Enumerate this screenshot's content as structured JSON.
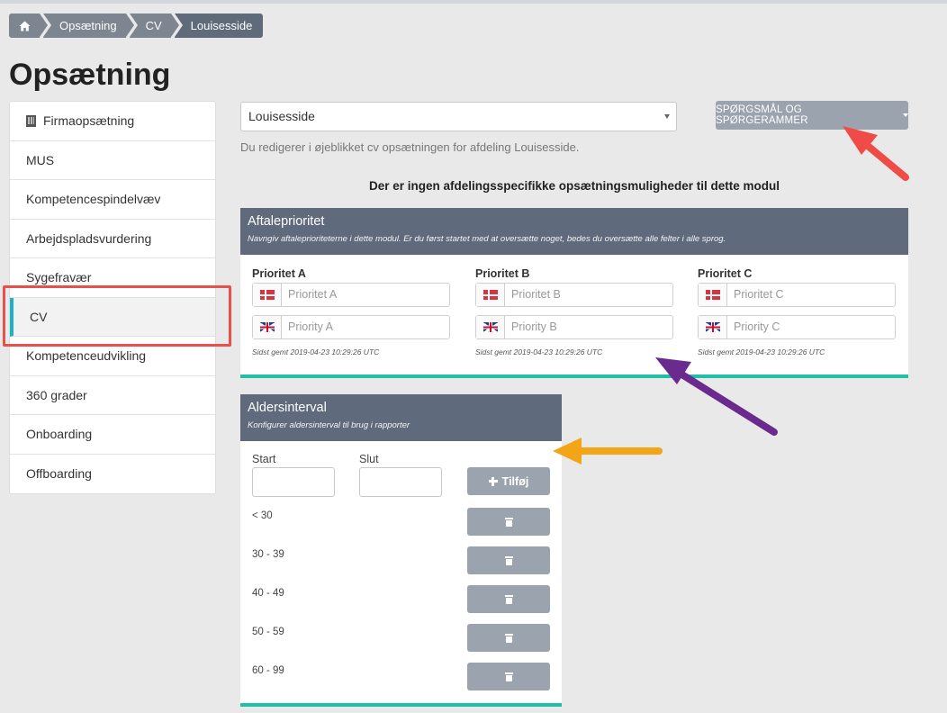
{
  "breadcrumb": {
    "home_icon": "home-icon",
    "items": [
      "Opsætning",
      "CV",
      "Louisesside"
    ]
  },
  "page": {
    "title": "Opsætning"
  },
  "sidebar": {
    "items": [
      {
        "label": "Firmaopsætning",
        "icon": "building-icon"
      },
      {
        "label": "MUS"
      },
      {
        "label": "Kompetencespindelvæv"
      },
      {
        "label": "Arbejdspladsvurdering"
      },
      {
        "label": "Sygefravær"
      },
      {
        "label": "CV",
        "active": true
      },
      {
        "label": "Kompetenceudvikling"
      },
      {
        "label": "360 grader"
      },
      {
        "label": "Onboarding"
      },
      {
        "label": "Offboarding"
      }
    ]
  },
  "department": {
    "selected": "Louisesside",
    "help": "Du redigerer i øjeblikket cv opsætningen for afdeling Louisesside."
  },
  "questions_button": {
    "label": "SPØRGSMÅL OG SPØRGERAMMER"
  },
  "notice": "Der er ingen afdelingsspecifikke opsætningsmuligheder til dette modul",
  "priority_panel": {
    "title": "Aftaleprioritet",
    "subtitle": "Navngiv aftaleprioriteterne i dette modul. Er du først startet med at oversætte noget, bedes du oversætte alle felter i alle sprog.",
    "columns": [
      {
        "label": "Prioritet A",
        "dk_placeholder": "Prioritet A",
        "en_placeholder": "Priority A",
        "saved": "Sidst gemt 2019-04-23 10:29:26 UTC"
      },
      {
        "label": "Prioritet B",
        "dk_placeholder": "Prioritet B",
        "en_placeholder": "Priority B",
        "saved": "Sidst gemt 2019-04-23 10:29:26 UTC"
      },
      {
        "label": "Prioritet C",
        "dk_placeholder": "Prioritet C",
        "en_placeholder": "Priority C",
        "saved": "Sidst gemt 2019-04-23 10:29:26 UTC"
      }
    ]
  },
  "age_panel": {
    "title": "Aldersinterval",
    "subtitle": "Konfigurer aldersinterval til brug i rapporter",
    "start_label": "Start",
    "end_label": "Slut",
    "add_label": "Tilføj",
    "intervals": [
      "< 30",
      "30 - 39",
      "40 - 49",
      "50 - 59",
      "60 - 99"
    ]
  },
  "colors": {
    "panel_header": "#5f6b7d",
    "accent_bar": "#1ec0a8",
    "active_marker": "#1cb3c8",
    "button": "#9aa3ae",
    "highlight_box": "#e8514a",
    "arrow_red": "#ef4b47",
    "arrow_purple": "#6a2a8e",
    "arrow_orange": "#f2a516"
  }
}
